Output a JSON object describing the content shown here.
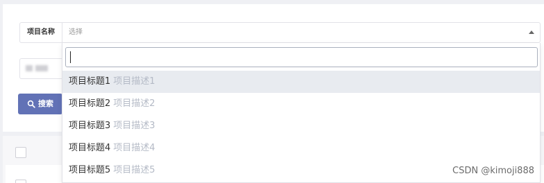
{
  "form": {
    "field_label": "项目名称",
    "select_placeholder": "选择",
    "search_button_label": "搜索"
  },
  "dropdown": {
    "search_value": "",
    "items": [
      {
        "title": "项目标题1",
        "desc": "项目描述1",
        "active": true
      },
      {
        "title": "项目标题2",
        "desc": "项目描述2",
        "active": false
      },
      {
        "title": "项目标题3",
        "desc": "项目描述3",
        "active": false
      },
      {
        "title": "项目标题4",
        "desc": "项目描述4",
        "active": false
      },
      {
        "title": "项目标题5",
        "desc": "项目描述5",
        "active": false
      }
    ]
  },
  "watermark": "CSDN @kimoji888",
  "colors": {
    "accent": "#6272b6",
    "page_bg": "#eff0f4",
    "item_active_bg": "#e8ebf0",
    "desc_text": "#b4bac6"
  },
  "icons": {
    "search_button": "search-icon",
    "select_caret": "caret-up-icon"
  }
}
